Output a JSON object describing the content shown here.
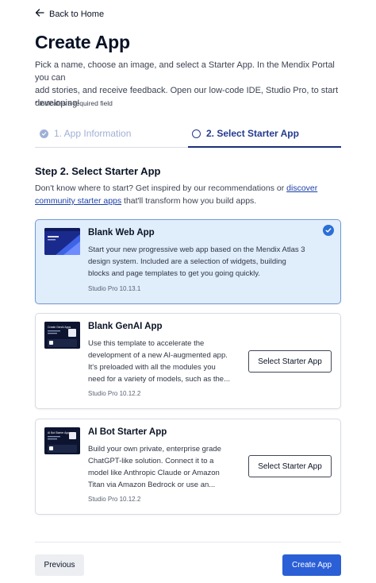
{
  "nav": {
    "back_label": "Back to Home"
  },
  "header": {
    "title": "Create App",
    "intro_lines": [
      "Pick a name, choose an image, and select a Starter App. In the Mendix Portal you can",
      "add stories, and receive feedback. Open our low-code IDE, Studio Pro, to start",
      "developing!"
    ],
    "required_note": "* indicates a required field"
  },
  "stepper": {
    "steps": [
      {
        "label": "1. App Information",
        "state": "completed"
      },
      {
        "label": "2. Select Starter App",
        "state": "current"
      }
    ]
  },
  "section": {
    "title": "Step 2. Select Starter App",
    "desc_before": "Don't know where to start? Get inspired by our recommendations or ",
    "desc_link_line1": "discover",
    "desc_link_line2": "community starter apps",
    "desc_after": " that'll transform how you build apps."
  },
  "starter_apps": [
    {
      "title": "Blank Web App",
      "desc_lines": [
        "Start your new progressive web app based on the Mendix Atlas 3",
        "design system. Included are a selection of widgets, building",
        "blocks and page templates to get you going quickly."
      ],
      "version": "Studio Pro 10.13.1",
      "selected": true
    },
    {
      "title": "Blank GenAI App",
      "desc_lines": [
        "Use this template to accelerate the",
        "development of a new AI-augmented app.",
        "It's preloaded with all the modules you",
        "need for a variety of models, such as the..."
      ],
      "version": "Studio Pro 10.12.2",
      "button_label": "Select Starter App",
      "thumb_caption": "Create GenAI Apps"
    },
    {
      "title": "AI Bot Starter App",
      "desc_lines": [
        "Build your own private, enterprise grade",
        "ChatGPT-like solution. Connect it to a",
        "model like Anthropic Claude or Amazon",
        "Titan via Amazon Bedrock or use an..."
      ],
      "version": "Studio Pro 10.12.2",
      "button_label": "Select Starter App",
      "thumb_caption": "AI Bot Starter App"
    }
  ],
  "footer": {
    "previous_label": "Previous",
    "create_label": "Create App"
  },
  "colors": {
    "primary": "#2b5fd6",
    "stepper_active": "#1b2f7a",
    "selected_card_bg": "#e0edfb"
  }
}
